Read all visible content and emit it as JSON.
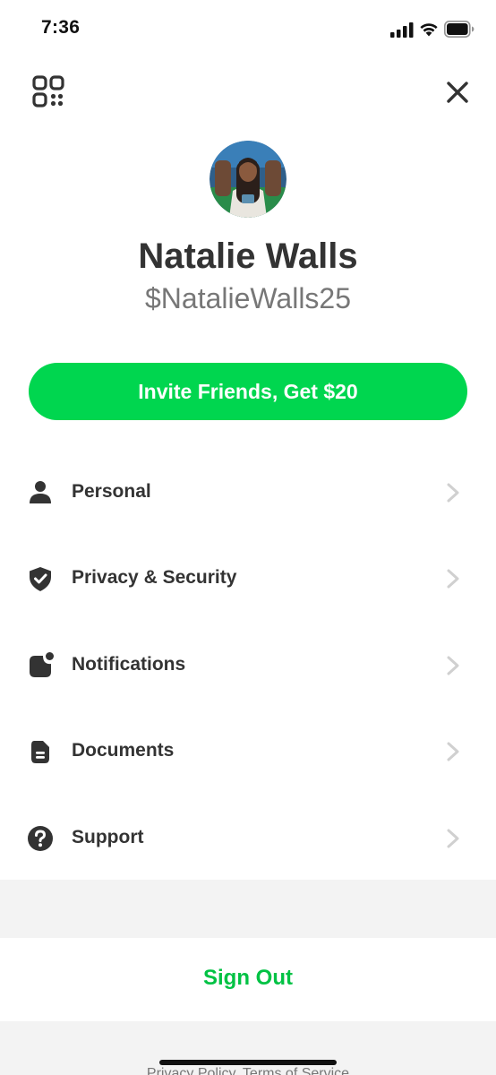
{
  "status_bar": {
    "time": "7:36"
  },
  "toolbar": {
    "qr_icon": "qr-code-icon",
    "close_icon": "close-icon"
  },
  "profile": {
    "name": "Natalie Walls",
    "handle": "$NatalieWalls25",
    "avatar_icon": "profile-photo"
  },
  "invite": {
    "label": "Invite Friends, Get $20"
  },
  "menu": {
    "items": [
      {
        "label": "Personal",
        "icon": "person-icon"
      },
      {
        "label": "Privacy & Security",
        "icon": "shield-check-icon"
      },
      {
        "label": "Notifications",
        "icon": "notification-icon"
      },
      {
        "label": "Documents",
        "icon": "document-icon"
      },
      {
        "label": "Support",
        "icon": "question-icon"
      }
    ]
  },
  "sign_out": {
    "label": "Sign Out"
  },
  "footer": {
    "links": "Privacy Policy, Terms of Service"
  },
  "colors": {
    "brand_green": "#00d64f",
    "sign_out_green": "#00c244",
    "text_dark": "#333333",
    "text_gray": "#777777",
    "section_gray": "#f3f3f3"
  }
}
